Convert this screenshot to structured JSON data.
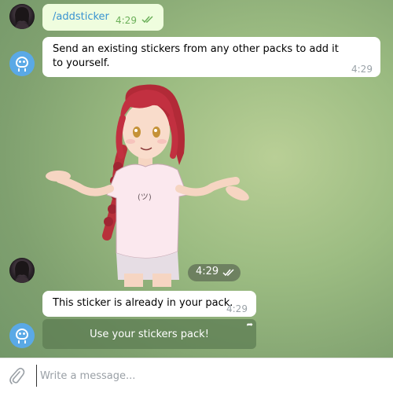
{
  "messages": [
    {
      "sender": "user",
      "text": "/addsticker",
      "time": "4:29",
      "read": true
    },
    {
      "sender": "bot",
      "text": "Send an existing stickers from any other packs to add it to yourself.",
      "time": "4:29"
    },
    {
      "sender": "user",
      "type": "sticker",
      "time": "4:29",
      "read": true
    },
    {
      "sender": "bot",
      "text": "This sticker is already in your pack.",
      "time": "4:29"
    }
  ],
  "inline_button": {
    "label": "Use your stickers pack!"
  },
  "composer": {
    "placeholder": "Write a message..."
  },
  "icons": {
    "attach": "paperclip-icon",
    "read": "double-check-icon",
    "bot_avatar": "bot-avatar-icon",
    "button_link": "share-arrow-icon"
  },
  "colors": {
    "outgoing_bubble": "#effdde",
    "incoming_bubble": "#ffffff",
    "command_link": "#3a93d1",
    "read_check": "#6cb05a",
    "bot_avatar": "#5aa9e6"
  }
}
